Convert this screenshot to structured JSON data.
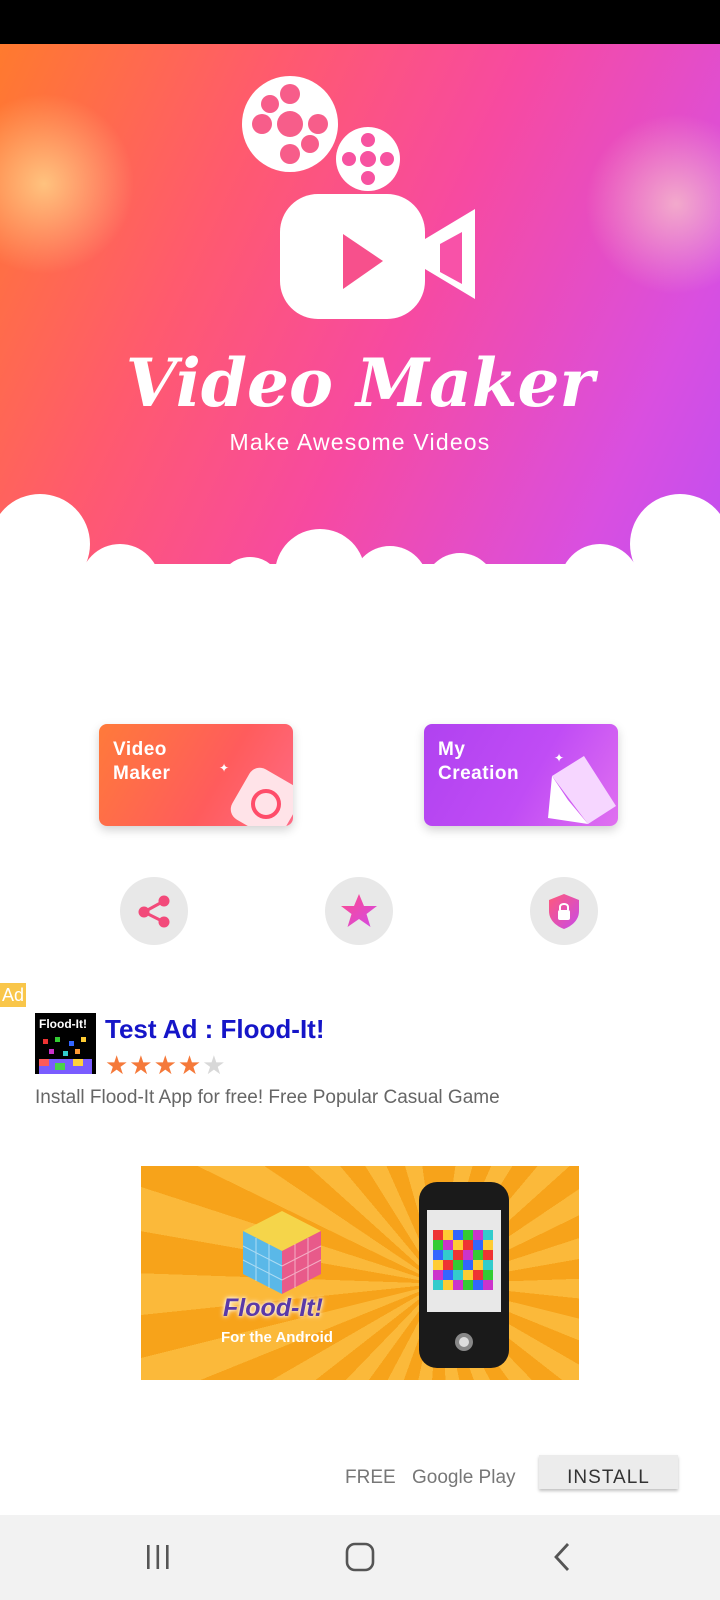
{
  "app": {
    "title": "Video Maker",
    "tagline": "Make Awesome Videos"
  },
  "tiles": {
    "video_maker": "Video\nMaker",
    "my_creation": "My\nCreation"
  },
  "actions": {
    "share_icon": "share-icon",
    "rate_icon": "star-icon",
    "privacy_icon": "shield-lock-icon"
  },
  "ad": {
    "badge": "Ad",
    "icon_text": "Flood-It!",
    "title": "Test Ad : Flood-It!",
    "rating": 4,
    "rating_max": 5,
    "stars_on": "★★★★",
    "stars_off": "★",
    "description": "Install Flood-It App for free! Free Popular Casual Game",
    "banner_title": "Flood-It!",
    "banner_subtitle": "For the Android",
    "price": "FREE",
    "store": "Google Play",
    "install_label": "INSTALL"
  },
  "colors": {
    "ad_title": "#1515c8",
    "star": "#f5793a",
    "tile_maker": "#ff6a4a",
    "tile_creation": "#b846f2"
  }
}
